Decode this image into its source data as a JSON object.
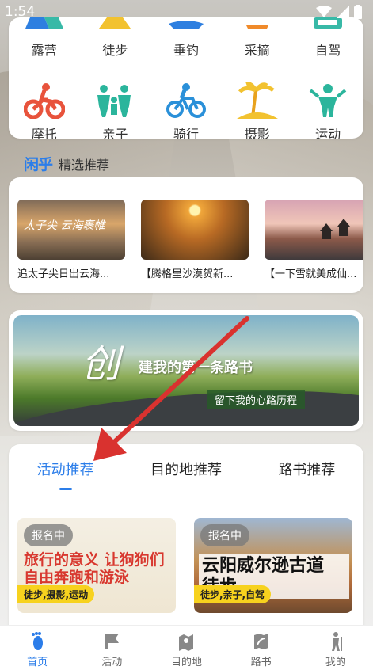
{
  "status": {
    "time": "1:54"
  },
  "categories_row1": [
    {
      "label": "露营",
      "icon": "camping-icon"
    },
    {
      "label": "徒步",
      "icon": "hiking-icon"
    },
    {
      "label": "垂钓",
      "icon": "fishing-icon"
    },
    {
      "label": "采摘",
      "icon": "picking-icon"
    },
    {
      "label": "自驾",
      "icon": "self-drive-icon"
    }
  ],
  "categories_row2": [
    {
      "label": "摩托",
      "icon": "motorcycle-icon"
    },
    {
      "label": "亲子",
      "icon": "family-icon"
    },
    {
      "label": "骑行",
      "icon": "cycling-icon"
    },
    {
      "label": "摄影",
      "icon": "photography-icon"
    },
    {
      "label": "运动",
      "icon": "sports-icon"
    }
  ],
  "featured": {
    "brand": "闲乎",
    "title": "精选推荐",
    "items": [
      {
        "caption": "追太子尖日出云海...",
        "thumb_text": "太子尖 云海裹帷"
      },
      {
        "caption": "【腾格里沙漠贺新...",
        "thumb_text": ""
      },
      {
        "caption": "【一下雪就美成仙...",
        "thumb_text": ""
      }
    ]
  },
  "banner": {
    "big": "创",
    "line1": "建我的第一条路书",
    "line2": "留下我的心路历程"
  },
  "tabs": [
    "活动推荐",
    "目的地推荐",
    "路书推荐"
  ],
  "activities": [
    {
      "badge": "报名中",
      "headline": "旅行的意义 让狗狗们 自由奔跑和游泳",
      "tags": "徒步,摄影,运动"
    },
    {
      "badge": "报名中",
      "headline": "云阳威尔逊古道 徒步",
      "tags": "徒步,亲子,自驾"
    }
  ],
  "bottom_nav": [
    {
      "label": "首页",
      "icon": "home-footprint-icon",
      "active": true
    },
    {
      "label": "活动",
      "icon": "flag-icon",
      "active": false
    },
    {
      "label": "目的地",
      "icon": "map-pin-icon",
      "active": false
    },
    {
      "label": "路书",
      "icon": "route-map-icon",
      "active": false
    },
    {
      "label": "我的",
      "icon": "hiker-icon",
      "active": false
    }
  ],
  "colors": {
    "accent": "#2b7de9",
    "tag": "#f7d21e",
    "arrow": "#d9322f"
  }
}
